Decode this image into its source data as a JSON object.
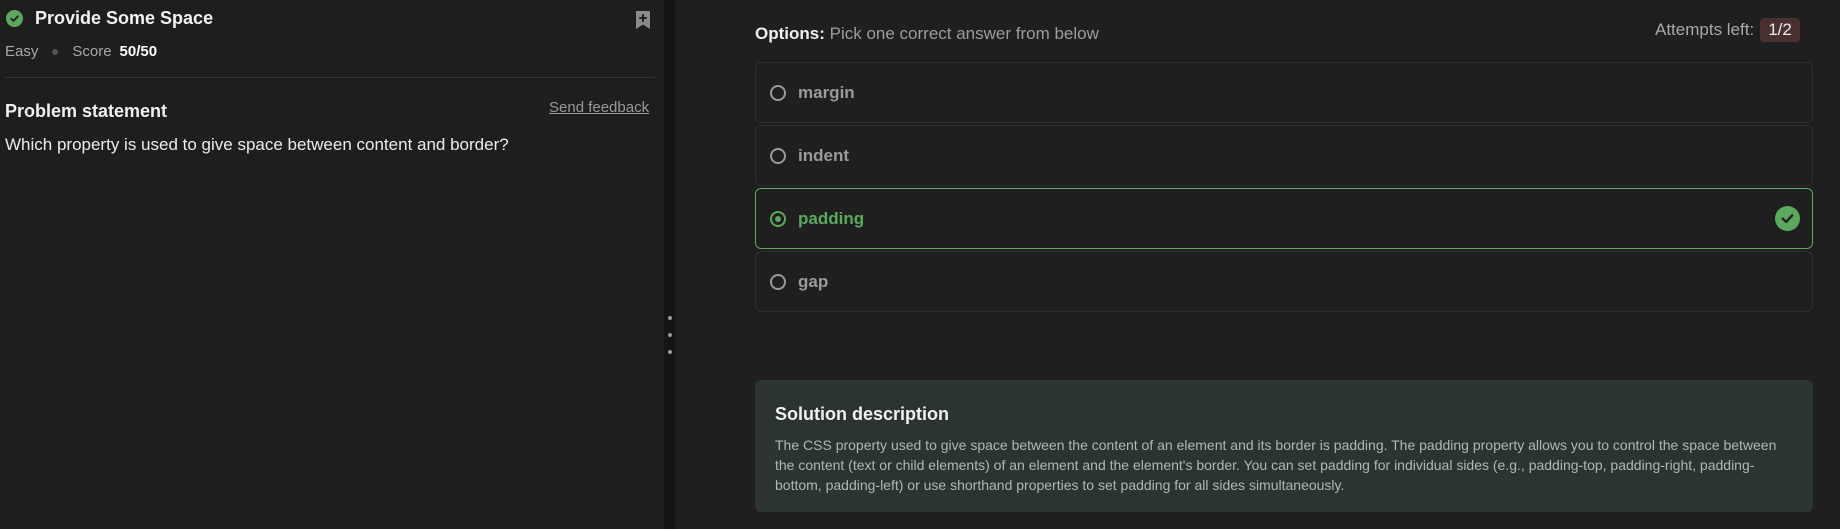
{
  "problem": {
    "title": "Provide Some Space",
    "difficulty": "Easy",
    "score_label": "Score",
    "score_value": "50/50",
    "statement_heading": "Problem statement",
    "feedback_link": "Send feedback",
    "question": "Which property is used to give space between content and border?"
  },
  "options_header": {
    "label": "Options:",
    "instruction": "Pick one correct answer from below",
    "attempts_label": "Attempts left:",
    "attempts_value": "1/2"
  },
  "options": [
    {
      "label": "margin",
      "state": "unselected"
    },
    {
      "label": "indent",
      "state": "unselected"
    },
    {
      "label": "padding",
      "state": "selected-correct"
    },
    {
      "label": "gap",
      "state": "unselected"
    }
  ],
  "solution": {
    "title": "Solution description",
    "text": "The CSS property used to give space between the content of an element and its border is padding. The padding property allows you to control the space between the content (text or child elements) of an element and the element's border. You can set padding for individual sides (e.g., padding-top, padding-right, padding-bottom, padding-left) or use shorthand properties to set padding for all sides simultaneously."
  },
  "icons": {
    "status": "check-circle-icon",
    "bookmark": "bookmark-add-icon",
    "splitter": "drag-handle-icon",
    "correct": "check-circle-icon"
  },
  "colors": {
    "success": "#5aaa5e",
    "attempts_badge": "#4a3030",
    "solution_bg": "#2b3333"
  }
}
